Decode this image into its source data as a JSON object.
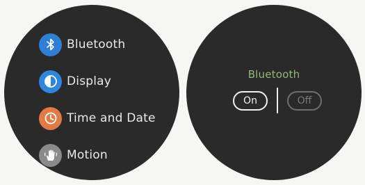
{
  "menu": {
    "items": [
      {
        "label": "Bluetooth",
        "icon": "bluetooth-icon",
        "icon_color": "#2f7fd6"
      },
      {
        "label": "Display",
        "icon": "display-icon",
        "icon_color": "#2f86dd"
      },
      {
        "label": "Time and Date",
        "icon": "clock-icon",
        "icon_color": "#e27a45"
      },
      {
        "label": "Motion",
        "icon": "motion-hand-icon",
        "icon_color": "#8b8b8b"
      }
    ]
  },
  "bluetooth_screen": {
    "title": "Bluetooth",
    "title_color": "#8fb87a",
    "on_label": "On",
    "off_label": "Off",
    "selected": "On",
    "on_color": "#f0f0f0",
    "off_color": "#7a7a7a"
  }
}
